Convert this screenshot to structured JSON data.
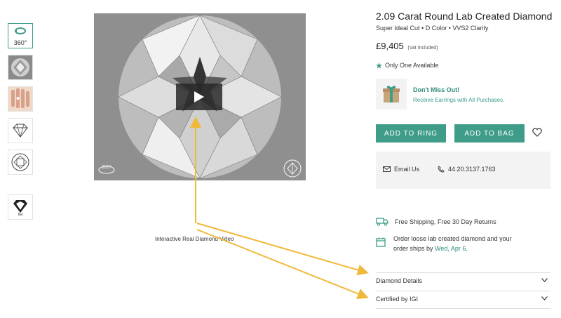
{
  "product": {
    "title": "2.09 Carat Round Lab Created Diamond",
    "subtitle": "Super Ideal Cut • D Color • VVS2 Clarity",
    "price": "£9,405",
    "vat_note": "(Vat Included)",
    "availability": "Only One Available"
  },
  "thumbnails": {
    "label_360": "360°",
    "items": [
      "360-view",
      "diamond-top",
      "hand-model",
      "diamond-side-diagram",
      "diamond-top-diagram",
      "certificate-logo"
    ]
  },
  "media": {
    "overlay_label": "360°",
    "caption": "Interactive Real Diamond Video"
  },
  "promo": {
    "title": "Don't Miss Out!",
    "subtitle": "Receive Earrings with All Purchases."
  },
  "actions": {
    "add_to_ring": "ADD TO RING",
    "add_to_bag": "ADD TO BAG"
  },
  "contact": {
    "email_label": "Email Us",
    "phone": "44.20.3137.1763"
  },
  "shipping": {
    "free_shipping": "Free Shipping, Free 30 Day Returns",
    "order_line1": "Order loose lab created diamond and your",
    "order_line2_prefix": "order ships by",
    "ship_date": "Wed, Apr 6",
    "order_line2_suffix": "."
  },
  "accordions": {
    "diamond_details": "Diamond Details",
    "certified_by": "Certified by IGI"
  },
  "colors": {
    "accent": "#3e9c89",
    "accent_text": "#2e8c7a",
    "annotation_arrow": "#f0b93a"
  },
  "icons": [
    "rotate-360-icon",
    "play-icon",
    "star-icon",
    "gift-box-icon",
    "heart-icon",
    "envelope-icon",
    "phone-icon",
    "truck-icon",
    "calendar-icon",
    "chevron-down-icon"
  ]
}
